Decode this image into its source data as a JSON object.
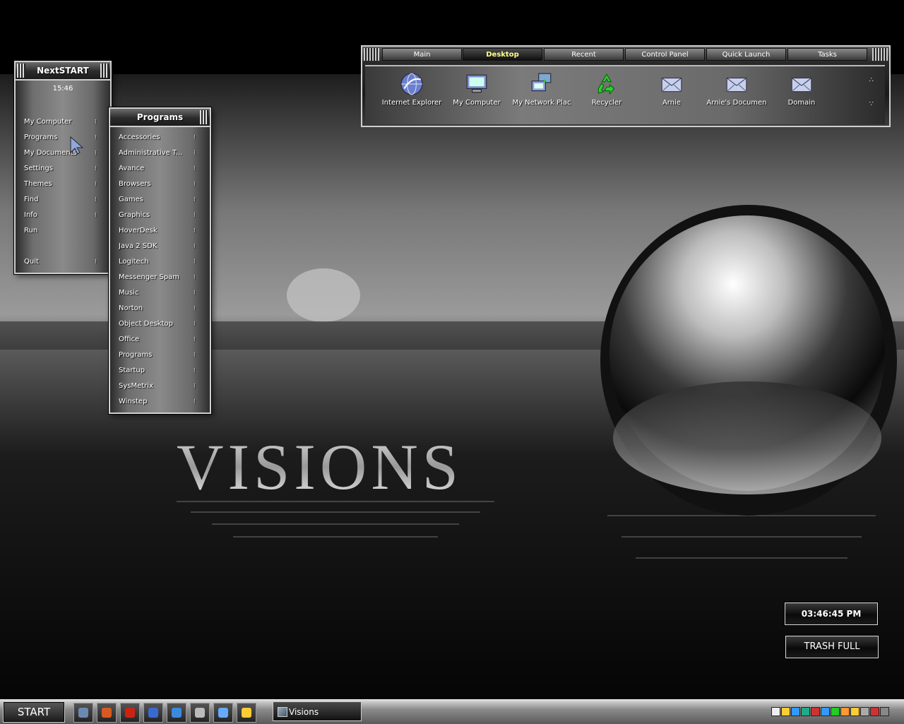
{
  "wallpaper": {
    "brand_text": "VISIONS"
  },
  "nextstart": {
    "title": "NextSTART",
    "time": "15:46",
    "items": [
      {
        "label": "My Computer"
      },
      {
        "label": "Programs"
      },
      {
        "label": "My Documents"
      },
      {
        "label": "Settings"
      },
      {
        "label": "Themes"
      },
      {
        "label": "Find"
      },
      {
        "label": "Info"
      },
      {
        "label": "Run"
      },
      {
        "label": "Quit"
      }
    ]
  },
  "programs": {
    "title": "Programs",
    "items": [
      {
        "label": "Accessories"
      },
      {
        "label": "Administrative T..."
      },
      {
        "label": "Avance"
      },
      {
        "label": "Browsers"
      },
      {
        "label": "Games"
      },
      {
        "label": "Graphics"
      },
      {
        "label": "HoverDesk"
      },
      {
        "label": "Java 2 SDK"
      },
      {
        "label": "Logitech"
      },
      {
        "label": "Messenger Spam"
      },
      {
        "label": "Music"
      },
      {
        "label": "Norton"
      },
      {
        "label": "Object Desktop"
      },
      {
        "label": "Office"
      },
      {
        "label": "Programs"
      },
      {
        "label": "Startup"
      },
      {
        "label": "SysMetrix"
      },
      {
        "label": "Winstep"
      }
    ]
  },
  "topbar": {
    "tabs": [
      {
        "label": "Main"
      },
      {
        "label": "Desktop"
      },
      {
        "label": "Recent"
      },
      {
        "label": "Control Panel"
      },
      {
        "label": "Quick Launch"
      },
      {
        "label": "Tasks"
      }
    ],
    "active_tab": "Desktop",
    "items": [
      {
        "label": "Internet Explorer",
        "icon": "globe-icon"
      },
      {
        "label": "My Computer",
        "icon": "monitor-icon"
      },
      {
        "label": "My Network Plac",
        "icon": "network-icon"
      },
      {
        "label": "Recycler",
        "icon": "recycle-icon"
      },
      {
        "label": "Arnie",
        "icon": "envelope-icon"
      },
      {
        "label": "Arnie's Documen",
        "icon": "envelope-icon"
      },
      {
        "label": "Domain",
        "icon": "envelope-icon"
      }
    ]
  },
  "widgets": {
    "clock": "03:46:45 PM",
    "trash": "TRASH FULL"
  },
  "taskbar": {
    "start_label": "START",
    "quick_launch": [
      "desktop-icon",
      "mail-icon",
      "app-icon",
      "ie-icon",
      "ie-alt-icon",
      "calendar-icon",
      "tool-icon",
      "media-icon"
    ],
    "task": "Visions"
  },
  "colors": {
    "accent_active_tab": "#ffff88",
    "panel_border": "#cfcfcf"
  }
}
